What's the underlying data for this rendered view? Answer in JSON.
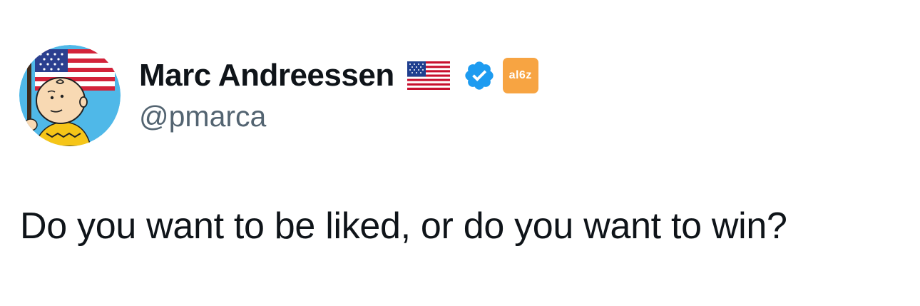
{
  "tweet": {
    "author": {
      "display_name": "Marc Andreessen",
      "handle": "@pmarca",
      "flag_icon": "us-flag-icon",
      "verified_icon": "verified-badge-icon",
      "affiliate_badge_text": "al6z",
      "avatar_icon": "charlie-brown-holding-us-flag-avatar"
    },
    "text": "Do you want to be liked, or do you want to win?"
  },
  "colors": {
    "text_primary": "#0f1419",
    "text_secondary": "#536471",
    "verified_blue": "#1d9bf0",
    "affiliate_orange": "#f7a442",
    "avatar_background": "#4fb8e8"
  }
}
